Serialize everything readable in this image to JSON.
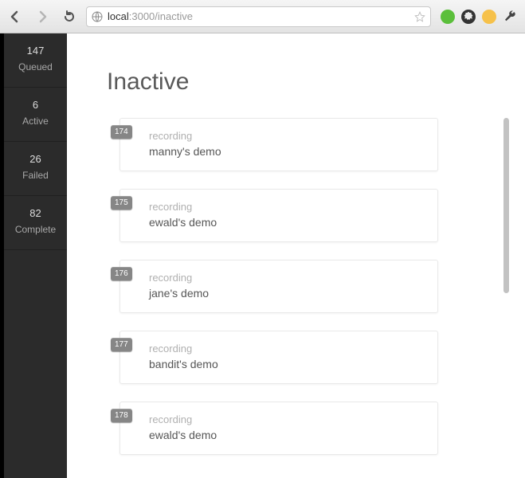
{
  "browser": {
    "url_prefix": "local",
    "url_rest": ":3000/inactive"
  },
  "sidebar": {
    "items": [
      {
        "count": "147",
        "label": "Queued"
      },
      {
        "count": "6",
        "label": "Active"
      },
      {
        "count": "26",
        "label": "Failed"
      },
      {
        "count": "82",
        "label": "Complete"
      }
    ]
  },
  "page": {
    "title": "Inactive"
  },
  "jobs": [
    {
      "id": "174",
      "type": "recording",
      "title": "manny's demo"
    },
    {
      "id": "175",
      "type": "recording",
      "title": "ewald's demo"
    },
    {
      "id": "176",
      "type": "recording",
      "title": "jane's demo"
    },
    {
      "id": "177",
      "type": "recording",
      "title": "bandit's demo"
    },
    {
      "id": "178",
      "type": "recording",
      "title": "ewald's demo"
    }
  ]
}
